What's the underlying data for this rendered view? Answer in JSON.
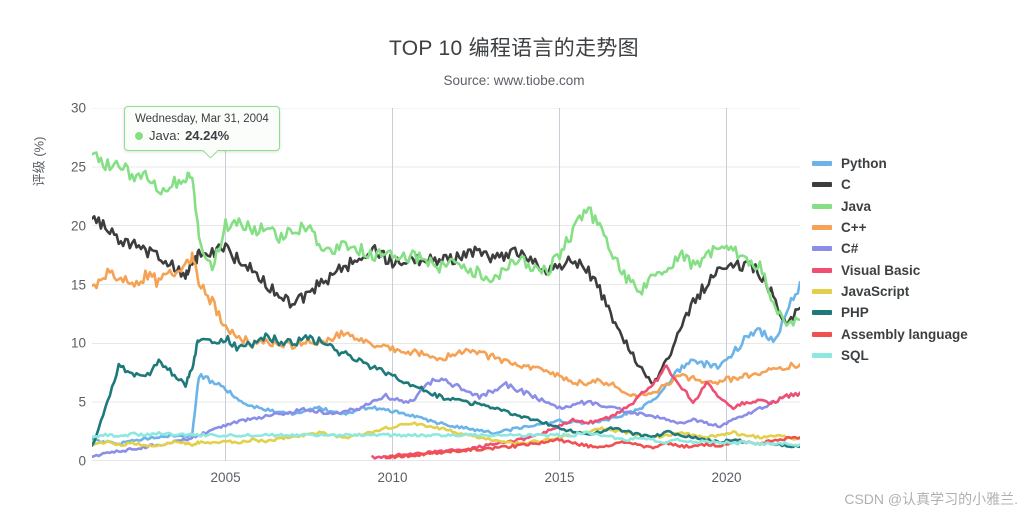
{
  "watermark": "CSDN @认真学习的小雅兰.",
  "tooltip": {
    "date": "Wednesday, Mar 31, 2004",
    "series": "Java:",
    "value": "24.24%",
    "color": "#85e085"
  },
  "chart_data": {
    "type": "line",
    "title": "TOP 10 编程语言的走势图",
    "subtitle": "Source: www.tiobe.com",
    "xlabel": "",
    "ylabel": "评级 (%)",
    "xlim": [
      2001.0,
      2022.2
    ],
    "ylim": [
      0,
      30
    ],
    "grid": true,
    "legend_position": "right",
    "yticks": [
      "30",
      "25",
      "20",
      "15",
      "10",
      "5",
      "0"
    ],
    "ytick_values": [
      30,
      25,
      20,
      15,
      10,
      5,
      0
    ],
    "xticks": [
      "2005",
      "2010",
      "2015",
      "2020"
    ],
    "xtick_values": [
      2005,
      2010,
      2015,
      2020
    ],
    "x": [
      2001.0,
      2001.4,
      2001.8,
      2002.2,
      2002.6,
      2003.0,
      2003.4,
      2003.8,
      2004.0,
      2004.2,
      2004.6,
      2005.0,
      2005.4,
      2005.8,
      2006.2,
      2006.6,
      2007.0,
      2007.4,
      2007.8,
      2008.2,
      2008.6,
      2009.0,
      2009.4,
      2009.8,
      2010.2,
      2010.6,
      2011.0,
      2011.4,
      2011.8,
      2012.2,
      2012.6,
      2013.0,
      2013.4,
      2013.8,
      2014.2,
      2014.6,
      2015.0,
      2015.4,
      2015.8,
      2016.2,
      2016.6,
      2017.0,
      2017.4,
      2017.8,
      2018.2,
      2018.6,
      2019.0,
      2019.4,
      2019.8,
      2020.2,
      2020.6,
      2021.0,
      2021.4,
      2021.8,
      2022.2
    ],
    "series": [
      {
        "name": "Python",
        "color": "#6cb4e8",
        "values": [
          1.8,
          1.6,
          1.5,
          1.7,
          1.9,
          2.0,
          2.2,
          2.1,
          2.3,
          7.2,
          6.8,
          6.2,
          5.0,
          4.6,
          4.4,
          4.2,
          4.0,
          4.3,
          4.5,
          4.2,
          4.0,
          4.4,
          4.6,
          4.3,
          4.1,
          3.8,
          3.5,
          3.2,
          3.0,
          2.8,
          2.6,
          2.4,
          2.6,
          2.8,
          3.0,
          3.2,
          3.4,
          3.3,
          3.2,
          3.4,
          3.6,
          4.0,
          4.4,
          5.2,
          6.5,
          7.8,
          8.5,
          8.2,
          8.0,
          9.2,
          10.5,
          11.0,
          10.2,
          12.5,
          15.2
        ]
      },
      {
        "name": "C",
        "color": "#3d3d3d",
        "values": [
          20.5,
          19.8,
          19.0,
          18.4,
          18.0,
          17.2,
          16.5,
          16.0,
          16.8,
          17.5,
          17.8,
          18.0,
          17.0,
          16.2,
          15.0,
          14.0,
          13.4,
          14.0,
          15.0,
          15.8,
          16.5,
          17.5,
          18.0,
          17.2,
          16.8,
          17.0,
          17.4,
          17.0,
          17.2,
          17.5,
          17.8,
          17.2,
          17.5,
          17.8,
          17.0,
          16.2,
          16.5,
          17.0,
          16.5,
          14.5,
          12.0,
          10.0,
          8.0,
          6.5,
          8.5,
          11.0,
          13.5,
          15.0,
          16.2,
          16.5,
          16.8,
          16.0,
          14.0,
          11.5,
          13.0
        ]
      },
      {
        "name": "Java",
        "color": "#85e085",
        "values": [
          26.5,
          25.0,
          25.5,
          24.0,
          24.5,
          23.0,
          23.5,
          24.2,
          24.24,
          19.0,
          16.5,
          20.0,
          20.5,
          19.5,
          20.0,
          19.0,
          19.5,
          20.0,
          18.5,
          18.0,
          18.5,
          18.0,
          17.5,
          17.8,
          17.2,
          17.5,
          17.0,
          16.5,
          17.0,
          16.5,
          16.0,
          15.5,
          16.5,
          17.0,
          16.5,
          16.0,
          17.5,
          19.5,
          21.5,
          20.0,
          17.5,
          15.5,
          14.5,
          15.5,
          16.5,
          17.5,
          16.5,
          17.5,
          18.0,
          17.8,
          17.2,
          16.5,
          13.5,
          11.5,
          12.0
        ]
      },
      {
        "name": "C++",
        "color": "#f5a254",
        "values": [
          14.5,
          16.0,
          15.5,
          15.0,
          15.8,
          15.2,
          16.0,
          17.0,
          17.5,
          15.0,
          13.5,
          11.5,
          10.5,
          10.0,
          10.2,
          10.0,
          9.8,
          10.2,
          10.0,
          10.5,
          10.8,
          10.2,
          10.0,
          9.8,
          9.5,
          9.2,
          9.0,
          8.8,
          9.0,
          9.5,
          9.2,
          8.8,
          8.5,
          8.2,
          8.0,
          7.5,
          7.2,
          6.8,
          6.5,
          6.8,
          6.5,
          5.8,
          5.5,
          5.8,
          6.5,
          7.2,
          7.0,
          6.5,
          6.8,
          7.0,
          7.2,
          7.5,
          7.8,
          8.0,
          8.2
        ]
      },
      {
        "name": "C#",
        "color": "#8b8ee8",
        "values": [
          0.4,
          0.6,
          0.8,
          1.0,
          1.2,
          1.4,
          1.6,
          1.8,
          2.0,
          2.2,
          2.6,
          3.0,
          3.4,
          3.6,
          3.8,
          4.0,
          4.2,
          4.4,
          4.2,
          4.0,
          4.2,
          4.5,
          5.0,
          5.5,
          5.2,
          5.0,
          6.5,
          7.0,
          6.5,
          6.0,
          5.5,
          6.0,
          6.5,
          6.0,
          5.5,
          5.0,
          4.5,
          4.8,
          5.0,
          4.8,
          4.5,
          4.2,
          4.0,
          3.8,
          3.5,
          3.2,
          3.5,
          3.2,
          3.0,
          3.5,
          4.0,
          4.5,
          5.0,
          5.5,
          5.8
        ]
      },
      {
        "name": "Visual Basic",
        "color": "#ee4f72",
        "values": [
          null,
          null,
          null,
          null,
          null,
          null,
          null,
          null,
          null,
          null,
          null,
          null,
          null,
          null,
          null,
          null,
          null,
          null,
          null,
          null,
          null,
          null,
          0.3,
          0.4,
          0.5,
          0.6,
          0.7,
          0.8,
          0.9,
          1.0,
          1.2,
          1.4,
          1.6,
          1.8,
          2.0,
          2.5,
          3.0,
          3.5,
          3.2,
          3.5,
          3.8,
          4.5,
          5.5,
          6.5,
          8.0,
          6.5,
          5.0,
          6.5,
          5.5,
          4.5,
          5.0,
          5.2,
          5.0,
          5.5,
          5.8
        ]
      },
      {
        "name": "JavaScript",
        "color": "#e3d04a",
        "values": [
          1.5,
          1.6,
          1.4,
          1.5,
          1.3,
          1.4,
          1.6,
          1.5,
          1.4,
          1.6,
          1.5,
          1.7,
          1.6,
          1.8,
          1.7,
          1.9,
          2.0,
          2.2,
          2.4,
          2.2,
          2.0,
          2.2,
          2.5,
          2.8,
          3.0,
          3.2,
          3.0,
          2.8,
          2.5,
          2.2,
          2.0,
          1.8,
          1.6,
          1.5,
          1.6,
          1.8,
          2.0,
          2.2,
          2.5,
          2.8,
          2.6,
          2.4,
          2.2,
          2.0,
          2.2,
          2.4,
          2.2,
          2.0,
          2.2,
          2.4,
          2.2,
          2.0,
          2.2,
          2.0,
          1.9
        ]
      },
      {
        "name": "PHP",
        "color": "#1e7a7a",
        "values": [
          1.2,
          4.5,
          8.0,
          7.5,
          7.0,
          8.5,
          7.5,
          6.5,
          8.0,
          10.5,
          10.0,
          10.5,
          9.5,
          10.0,
          10.5,
          10.2,
          10.0,
          10.5,
          10.2,
          9.5,
          9.0,
          8.5,
          8.0,
          7.5,
          7.0,
          6.5,
          6.0,
          5.5,
          5.2,
          5.0,
          4.8,
          4.5,
          4.2,
          3.8,
          3.5,
          3.2,
          2.8,
          2.5,
          2.2,
          2.5,
          2.8,
          2.5,
          2.2,
          2.0,
          2.5,
          2.2,
          2.0,
          1.8,
          1.6,
          1.8,
          1.6,
          1.5,
          1.4,
          1.3,
          1.2
        ]
      },
      {
        "name": "Assembly language",
        "color": "#f05050",
        "values": [
          null,
          null,
          null,
          null,
          null,
          null,
          null,
          null,
          null,
          null,
          null,
          null,
          null,
          null,
          null,
          null,
          null,
          null,
          null,
          null,
          null,
          null,
          null,
          0.3,
          0.4,
          0.5,
          0.6,
          0.7,
          0.8,
          0.9,
          1.0,
          1.1,
          1.2,
          1.3,
          1.5,
          1.6,
          1.8,
          1.5,
          1.3,
          1.2,
          1.4,
          1.6,
          1.3,
          1.1,
          1.5,
          1.3,
          1.2,
          1.4,
          1.3,
          1.5,
          1.6,
          1.5,
          1.7,
          1.9,
          2.0
        ]
      },
      {
        "name": "SQL",
        "color": "#8ee8e0",
        "values": [
          2.0,
          2.2,
          2.1,
          2.3,
          2.2,
          2.4,
          2.3,
          2.2,
          2.3,
          2.2,
          2.2,
          2.2,
          2.2,
          2.2,
          2.2,
          2.2,
          2.2,
          2.2,
          2.2,
          2.2,
          2.2,
          2.2,
          2.2,
          2.2,
          2.2,
          2.2,
          2.2,
          2.2,
          2.2,
          2.2,
          2.2,
          2.2,
          2.2,
          2.2,
          2.2,
          2.2,
          2.2,
          2.2,
          2.4,
          2.2,
          2.0,
          1.8,
          2.0,
          1.8,
          1.6,
          1.8,
          1.6,
          1.7,
          1.6,
          1.5,
          1.6,
          1.5,
          1.4,
          1.5,
          1.4
        ]
      }
    ]
  }
}
